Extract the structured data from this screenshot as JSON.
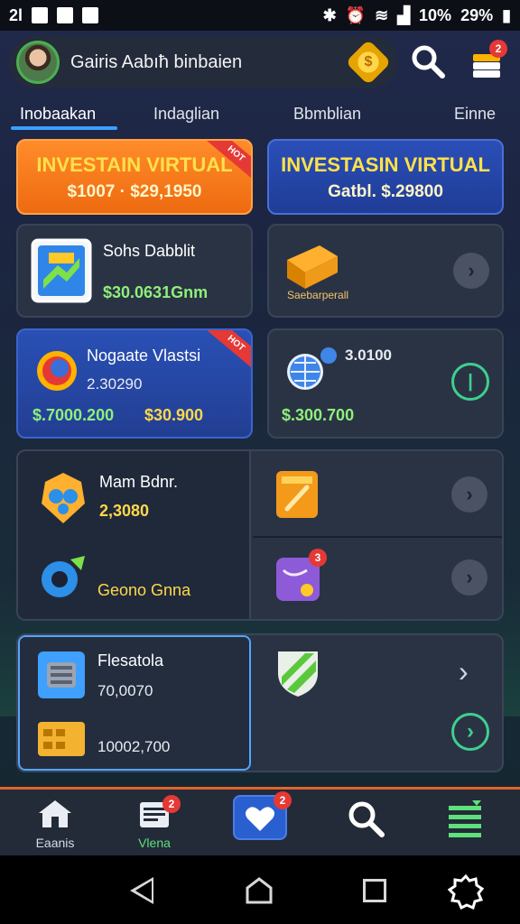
{
  "status_bar": {
    "time": "2l",
    "battery_text": "10%",
    "signal_text": "29%"
  },
  "header": {
    "title": "Gairis Aabıħ binbaien",
    "notification_count": "2"
  },
  "tabs": [
    "Inobaakan",
    "Indaglian",
    "Bbmblian",
    "Einne"
  ],
  "promo_cards": [
    {
      "title": "INVESTAIN VIRTUAL",
      "subtitle": "$1007 · $29,1950",
      "ribbon": "HOT"
    },
    {
      "title": "INVESTASIN VIRTUAL",
      "subtitle": "Gatbl.  $.29800"
    }
  ],
  "row1": {
    "left_title": "Sohs Dabblit",
    "left_value": "$30.0631Gnm",
    "right_label": "Saebarperall"
  },
  "row2": {
    "left_title": "Nogaate Vlastsi",
    "left_sub": "2.30290",
    "left_value_green": "$.7000.200",
    "left_value_gold": "$30.900",
    "ribbon": "HOT",
    "right_title": "3.0100",
    "right_value": "$.300.700"
  },
  "row3": {
    "left_title": "Mam Bdnr.",
    "left_value": "2,3080",
    "left_footer": "Geono Gnna",
    "right_badge": "3"
  },
  "row4": {
    "left_title": "Flesatola",
    "left_value": "70,0070",
    "left_footer": "10002,700"
  },
  "bottom_nav": {
    "items": [
      {
        "label": "Eaanis",
        "icon": "home-icon"
      },
      {
        "label": "Vlena",
        "icon": "news-icon",
        "badge": "2"
      },
      {
        "label": "",
        "icon": "heart-icon",
        "badge": "2"
      },
      {
        "label": "",
        "icon": "search-icon"
      },
      {
        "label": "",
        "icon": "list-icon"
      }
    ]
  },
  "colors": {
    "accent_orange": "#ee6a10",
    "accent_blue": "#2b4fb8",
    "positive_green": "#8ef07a",
    "gold": "#ffd84a"
  }
}
